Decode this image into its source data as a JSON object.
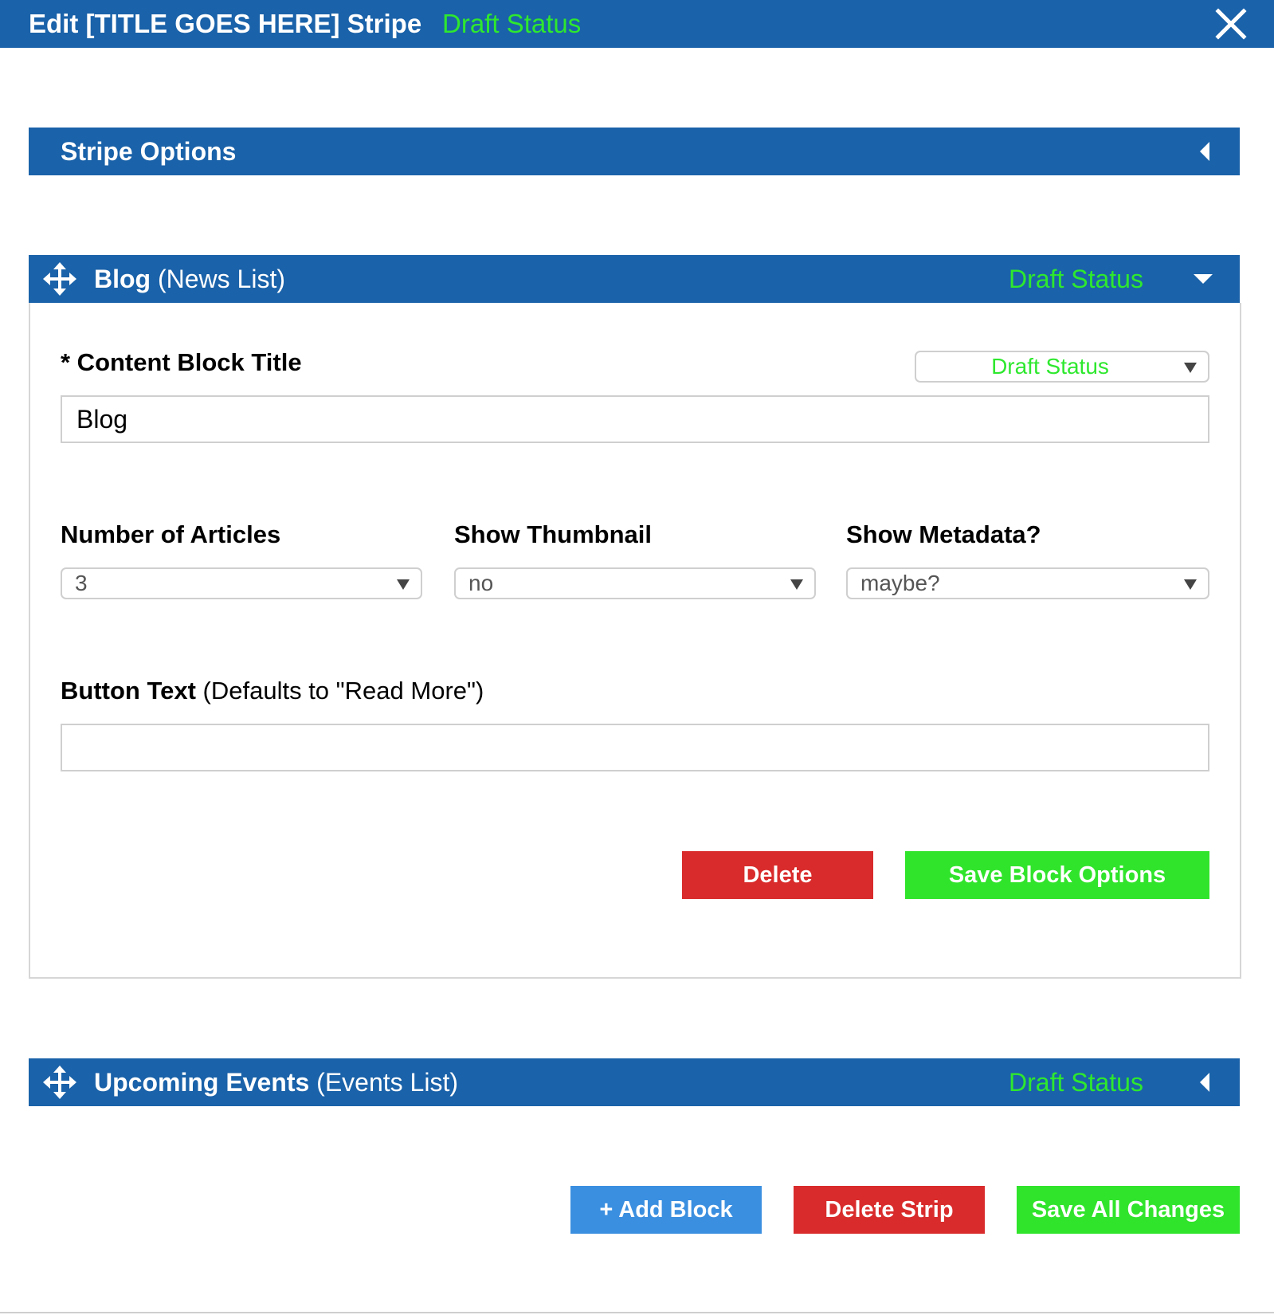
{
  "header": {
    "title": "Edit [TITLE GOES HERE] Stripe",
    "status": "Draft Status",
    "close_icon": "close-icon"
  },
  "stripe_options": {
    "title": "Stripe Options",
    "toggle_icon": "chevron-left-icon"
  },
  "blog_block": {
    "title_bold": "Blog",
    "title_type": "(News List)",
    "status": "Draft Status",
    "toggle_icon": "chevron-down-icon",
    "move_icon": "move-icon",
    "content_title_label": "* Content Block Title",
    "status_select_value": "Draft Status",
    "content_title_value": "Blog",
    "num_articles_label": "Number of Articles",
    "num_articles_value": "3",
    "show_thumbnail_label": "Show Thumbnail",
    "show_thumbnail_value": "no",
    "show_metadata_label": "Show Metadata?",
    "show_metadata_value": "maybe?",
    "button_text_label": "Button Text",
    "button_text_hint": "(Defaults to \"Read More\")",
    "button_text_value": "",
    "delete_label": "Delete",
    "save_label": "Save Block Options"
  },
  "events_block": {
    "title_bold": "Upcoming Events",
    "title_type": "(Events List)",
    "status": "Draft Status",
    "toggle_icon": "chevron-left-icon",
    "move_icon": "move-icon"
  },
  "footer": {
    "add_block_label": "+ Add Block",
    "delete_strip_label": "Delete Strip",
    "save_all_label": "Save All Changes"
  },
  "colors": {
    "brand_blue": "#1a62a9",
    "status_green": "#2ee82e",
    "delete_red": "#d92b2b",
    "save_green": "#30e42b",
    "add_blue": "#3b8fe0"
  }
}
